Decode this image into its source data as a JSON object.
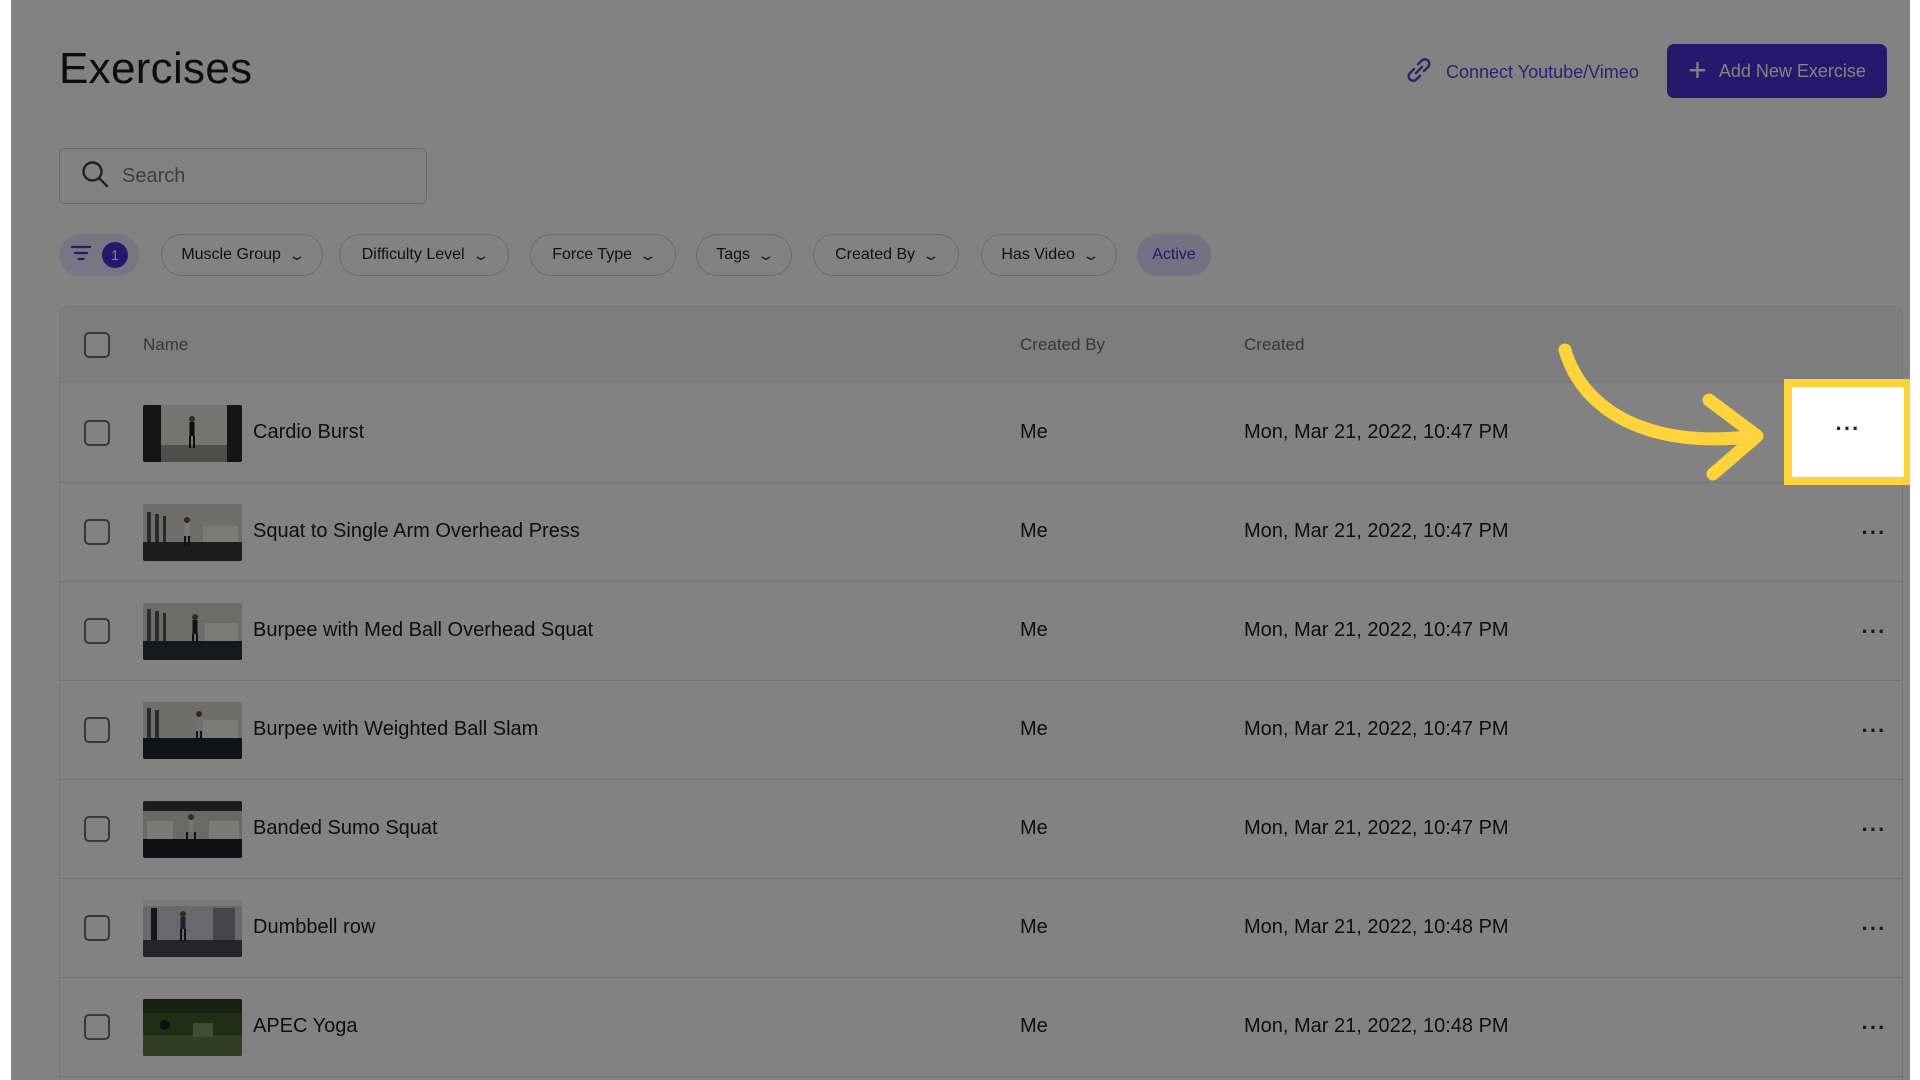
{
  "header": {
    "title": "Exercises",
    "connect_label": "Connect Youtube/Vimeo",
    "add_label": "Add New Exercise"
  },
  "search": {
    "placeholder": "Search",
    "value": ""
  },
  "filters": {
    "count": "1",
    "muscle_group": "Muscle Group",
    "difficulty": "Difficulty Level",
    "force_type": "Force Type",
    "tags": "Tags",
    "created_by": "Created By",
    "has_video": "Has Video",
    "active": "Active"
  },
  "table": {
    "columns": {
      "name": "Name",
      "created_by": "Created By",
      "created": "Created"
    },
    "rows": [
      {
        "name": "Cardio Burst",
        "created_by": "Me",
        "created": "Mon, Mar 21, 2022, 10:47 PM"
      },
      {
        "name": "Squat to Single Arm Overhead Press",
        "created_by": "Me",
        "created": "Mon, Mar 21, 2022, 10:47 PM"
      },
      {
        "name": "Burpee with Med Ball Overhead Squat",
        "created_by": "Me",
        "created": "Mon, Mar 21, 2022, 10:47 PM"
      },
      {
        "name": "Burpee with Weighted Ball Slam",
        "created_by": "Me",
        "created": "Mon, Mar 21, 2022, 10:47 PM"
      },
      {
        "name": "Banded Sumo Squat",
        "created_by": "Me",
        "created": "Mon, Mar 21, 2022, 10:47 PM"
      },
      {
        "name": "Dumbbell row",
        "created_by": "Me",
        "created": "Mon, Mar 21, 2022, 10:48 PM"
      },
      {
        "name": "APEC Yoga",
        "created_by": "Me",
        "created": "Mon, Mar 21, 2022, 10:48 PM"
      }
    ],
    "more_glyph": "···"
  },
  "colors": {
    "accent": "#4b30d6",
    "highlight": "#ffd33c",
    "overlay": "rgba(0,0,0,0.49)"
  },
  "icons": {
    "connect": "link-icon",
    "add": "plus-icon",
    "search": "search-icon",
    "filter": "filter-icon",
    "chevron": "chevron-down-icon",
    "more": "more-horizontal-icon",
    "arrow": "curved-arrow-icon"
  }
}
